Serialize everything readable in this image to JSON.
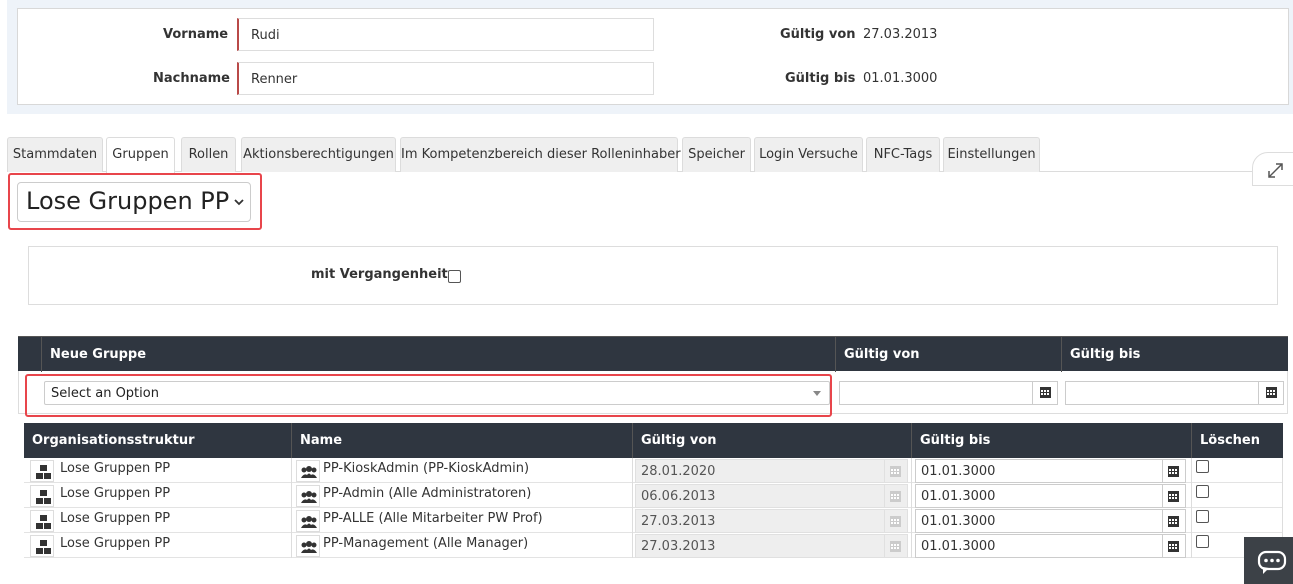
{
  "person": {
    "vorname_label": "Vorname",
    "vorname_value": "Rudi",
    "nachname_label": "Nachname",
    "nachname_value": "Renner",
    "gueltig_von_label": "Gültig von",
    "gueltig_von_value": "27.03.2013",
    "gueltig_bis_label": "Gültig bis",
    "gueltig_bis_value": "01.01.3000"
  },
  "tabs": [
    {
      "label": "Stammdaten"
    },
    {
      "label": "Gruppen"
    },
    {
      "label": "Rollen"
    },
    {
      "label": "Aktionsberechtigungen"
    },
    {
      "label": "Im Kompetenzbereich dieser Rolleninhaber"
    },
    {
      "label": "Speicher"
    },
    {
      "label": "Login Versuche"
    },
    {
      "label": "NFC-Tags"
    },
    {
      "label": "Einstellungen"
    }
  ],
  "active_tab": "Gruppen",
  "group_select": {
    "value": "Lose Gruppen PP"
  },
  "filter": {
    "mit_vergangenheit_label": "mit Vergangenheit"
  },
  "new_group_table": {
    "headers": {
      "neue_gruppe": "Neue Gruppe",
      "gueltig_von": "Gültig von",
      "gueltig_bis": "Gültig bis"
    },
    "select_placeholder": "Select an Option"
  },
  "groups_table": {
    "headers": {
      "org": "Organisationsstruktur",
      "name": "Name",
      "gueltig_von": "Gültig von",
      "gueltig_bis": "Gültig bis",
      "loeschen": "Löschen"
    },
    "rows": [
      {
        "org": "Lose Gruppen PP",
        "name": "PP-KioskAdmin (PP-KioskAdmin)",
        "von": "28.01.2020",
        "bis": "01.01.3000"
      },
      {
        "org": "Lose Gruppen PP",
        "name": "PP-Admin (Alle Administratoren)",
        "von": "06.06.2013",
        "bis": "01.01.3000"
      },
      {
        "org": "Lose Gruppen PP",
        "name": "PP-ALLE (Alle Mitarbeiter PW Prof)",
        "von": "27.03.2013",
        "bis": "01.01.3000"
      },
      {
        "org": "Lose Gruppen PP",
        "name": "PP-Management (Alle Manager)",
        "von": "27.03.2013",
        "bis": "01.01.3000"
      }
    ]
  },
  "colors": {
    "highlight": "#e8454b",
    "table_header": "#2f3640",
    "required_border": "#b94a48"
  }
}
